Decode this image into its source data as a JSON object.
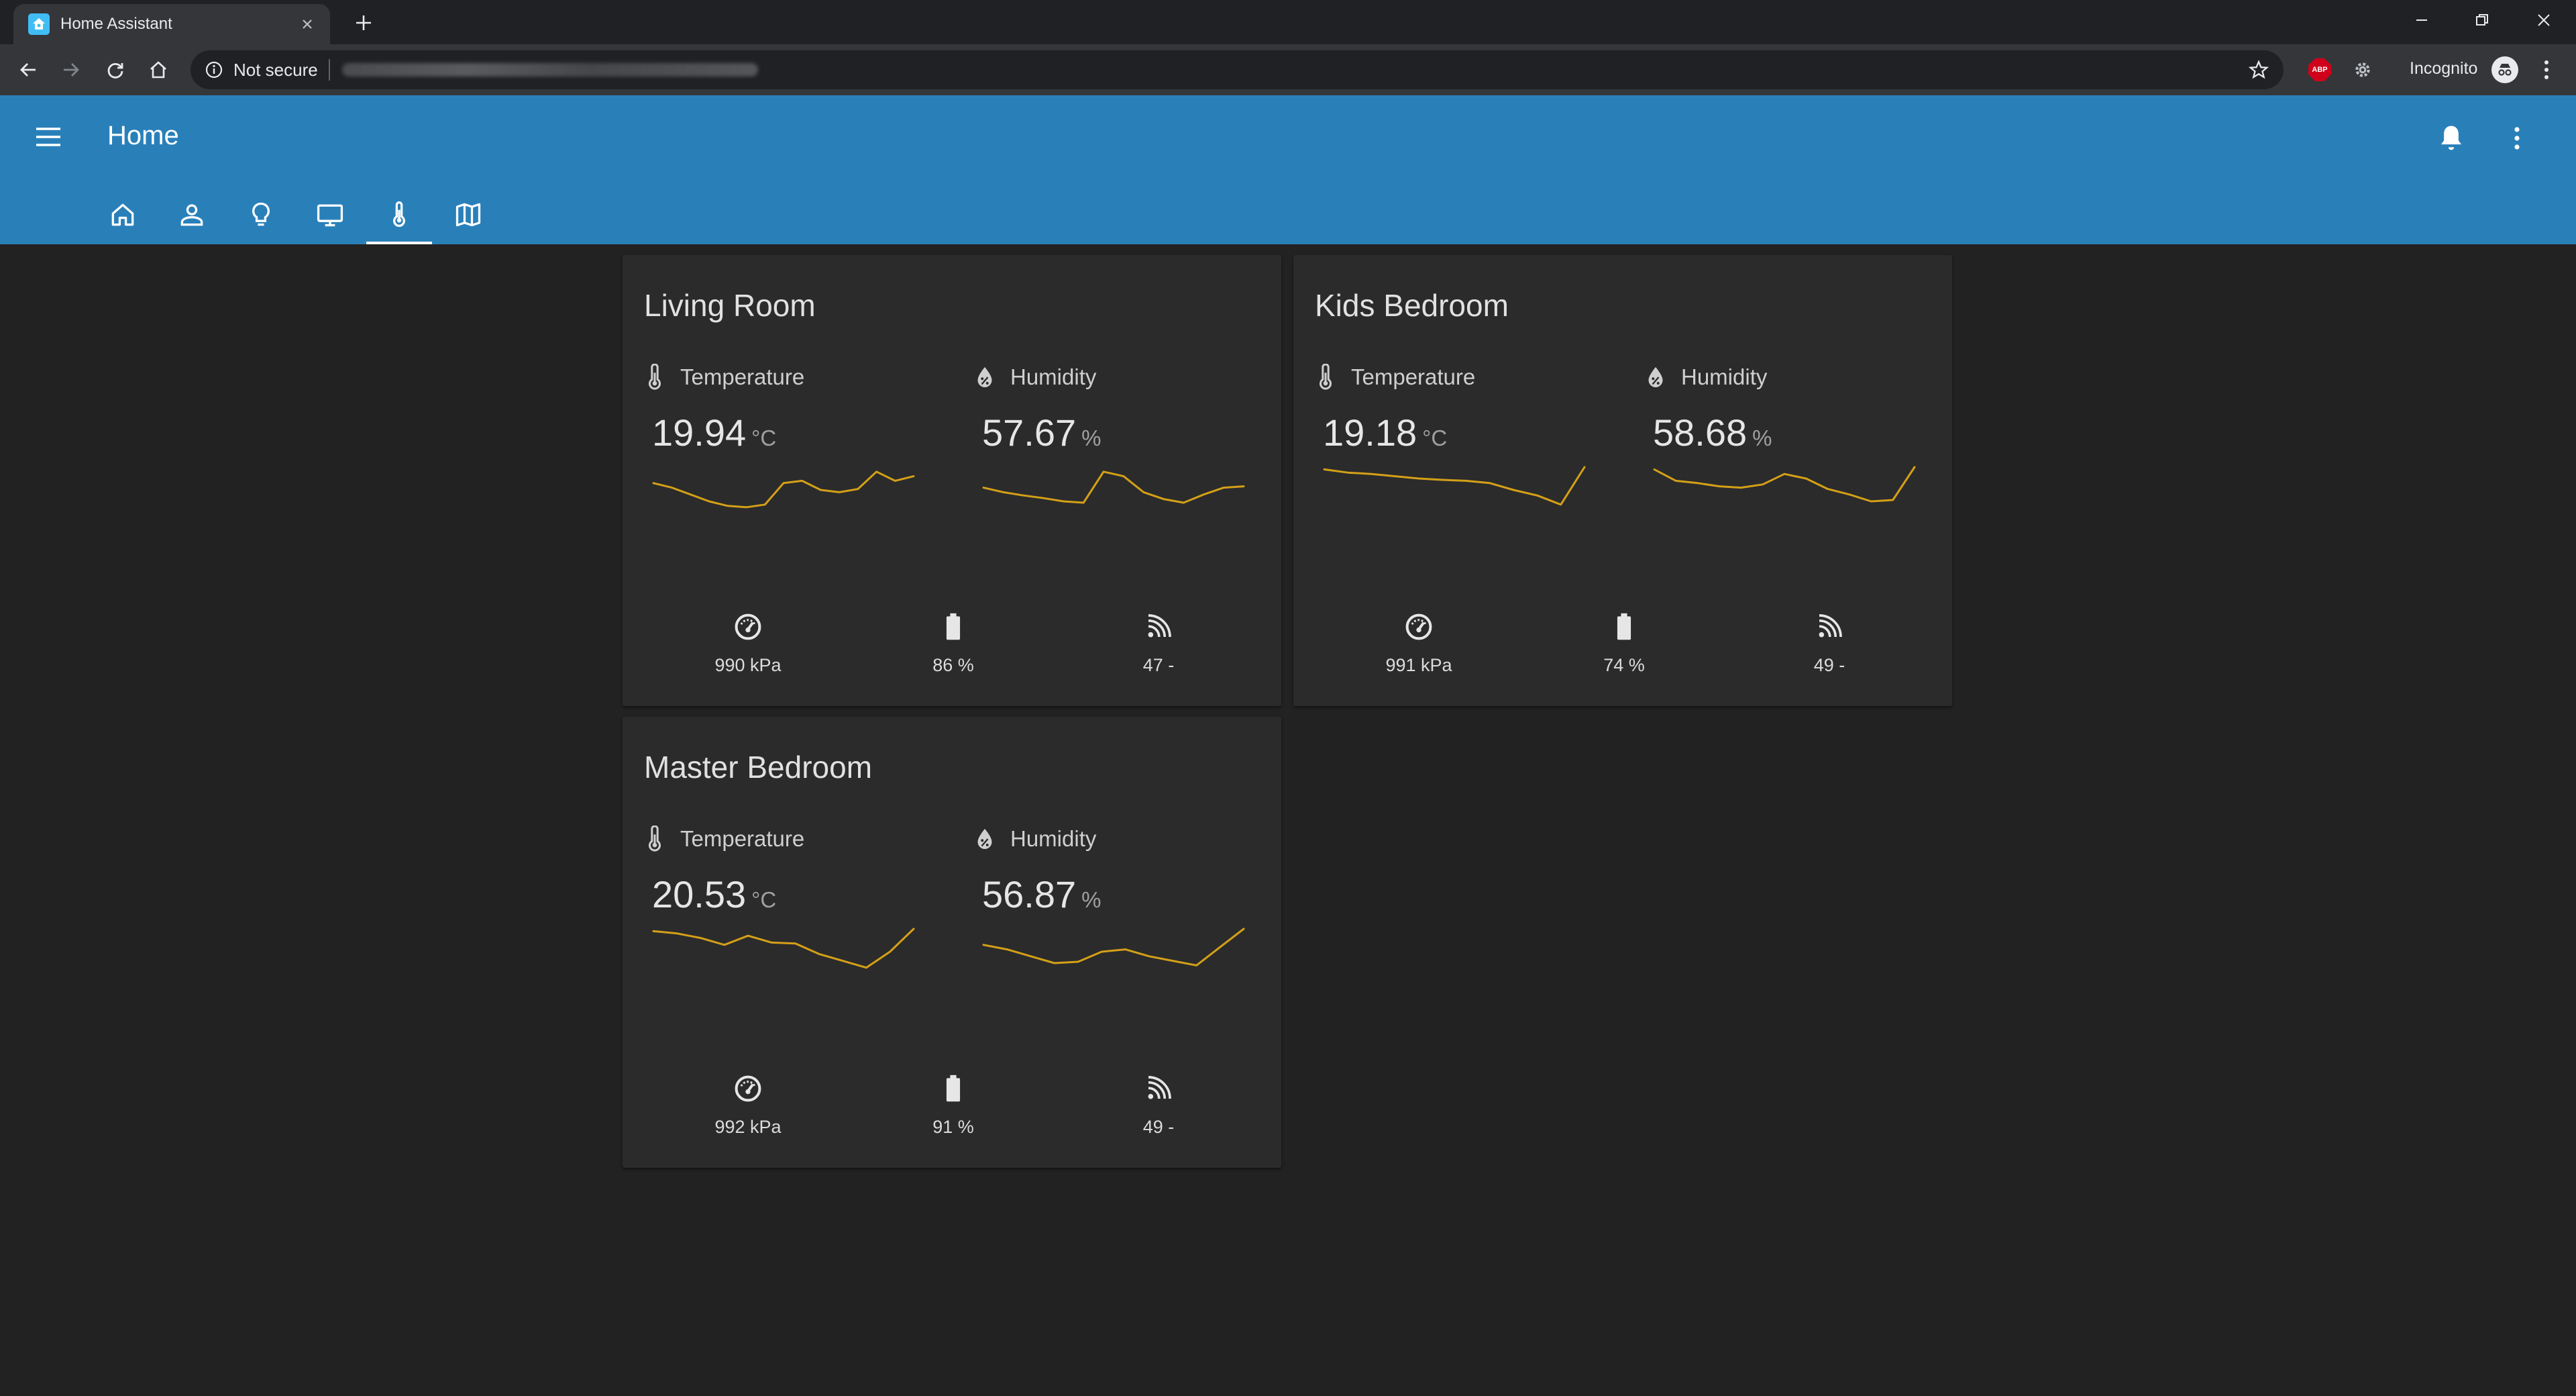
{
  "browser": {
    "tab_title": "Home Assistant",
    "security_label": "Not secure",
    "incognito_label": "Incognito",
    "adblock_label": "ABP"
  },
  "app": {
    "title": "Home",
    "views": [
      {
        "icon": "home-icon"
      },
      {
        "icon": "person-icon"
      },
      {
        "icon": "lightbulb-icon"
      },
      {
        "icon": "monitor-icon"
      },
      {
        "icon": "thermometer-icon",
        "active": true
      },
      {
        "icon": "map-icon"
      }
    ]
  },
  "rooms": [
    {
      "name": "Living Room",
      "temperature": {
        "label": "Temperature",
        "value": "19.94",
        "unit": "°C",
        "trend": [
          0.35,
          0.45,
          0.6,
          0.75,
          0.85,
          0.88,
          0.82,
          0.35,
          0.3,
          0.5,
          0.55,
          0.48,
          0.1,
          0.3,
          0.2
        ]
      },
      "humidity": {
        "label": "Humidity",
        "value": "57.67",
        "unit": "%",
        "trend": [
          0.45,
          0.55,
          0.62,
          0.68,
          0.75,
          0.78,
          0.1,
          0.2,
          0.55,
          0.7,
          0.78,
          0.6,
          0.45,
          0.42
        ]
      },
      "pressure": "990 kPa",
      "battery": "86 %",
      "signal": "47 -"
    },
    {
      "name": "Kids Bedroom",
      "temperature": {
        "label": "Temperature",
        "value": "19.18",
        "unit": "°C",
        "trend": [
          0.05,
          0.12,
          0.15,
          0.2,
          0.25,
          0.28,
          0.3,
          0.35,
          0.5,
          0.62,
          0.82,
          0.0
        ]
      },
      "humidity": {
        "label": "Humidity",
        "value": "58.68",
        "unit": "%",
        "trend": [
          0.05,
          0.3,
          0.35,
          0.42,
          0.45,
          0.38,
          0.15,
          0.25,
          0.48,
          0.6,
          0.75,
          0.72,
          0.0
        ]
      },
      "pressure": "991 kPa",
      "battery": "74 %",
      "signal": "49 -"
    },
    {
      "name": "Master Bedroom",
      "temperature": {
        "label": "Temperature",
        "value": "20.53",
        "unit": "°C",
        "trend": [
          0.05,
          0.1,
          0.2,
          0.35,
          0.15,
          0.3,
          0.32,
          0.55,
          0.7,
          0.85,
          0.5,
          0.0
        ]
      },
      "humidity": {
        "label": "Humidity",
        "value": "56.87",
        "unit": "%",
        "trend": [
          0.35,
          0.45,
          0.6,
          0.75,
          0.72,
          0.5,
          0.45,
          0.6,
          0.7,
          0.8,
          0.4,
          0.0
        ]
      },
      "pressure": "992 kPa",
      "battery": "91 %",
      "signal": "49 -"
    }
  ],
  "colors": {
    "accent": "#2980b9",
    "background": "#222222",
    "card": "#2b2b2b",
    "sparkline": "#d4a017"
  }
}
